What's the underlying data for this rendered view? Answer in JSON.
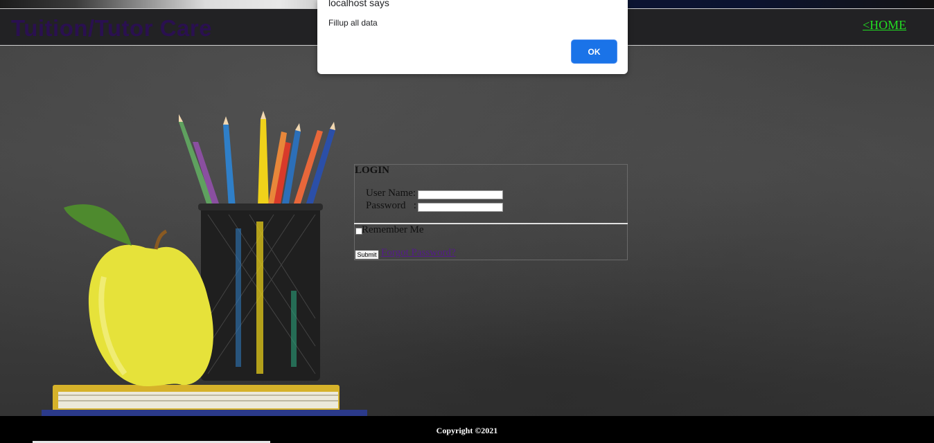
{
  "header": {
    "site_title": "Tuition/Tutor Care",
    "home_link": "<HOME"
  },
  "login": {
    "heading": "LOGIN",
    "username_label": "User Name",
    "username_colon": ":",
    "username_value": "",
    "password_label": "Password",
    "password_colon": ":",
    "password_value": "",
    "remember_label": "Remember Me",
    "remember_checked": false,
    "submit_label": "Submit",
    "forgot_link": "Forgot Password?"
  },
  "footer": {
    "copyright": "Copyright ©2021"
  },
  "alert": {
    "title": "localhost says",
    "message": "Fillup all data",
    "ok_label": "OK"
  },
  "colors": {
    "home_link": "#22dd22",
    "site_title": "#2a1050",
    "ok_button": "#1a73e8",
    "forgot_link": "#551a8b"
  }
}
